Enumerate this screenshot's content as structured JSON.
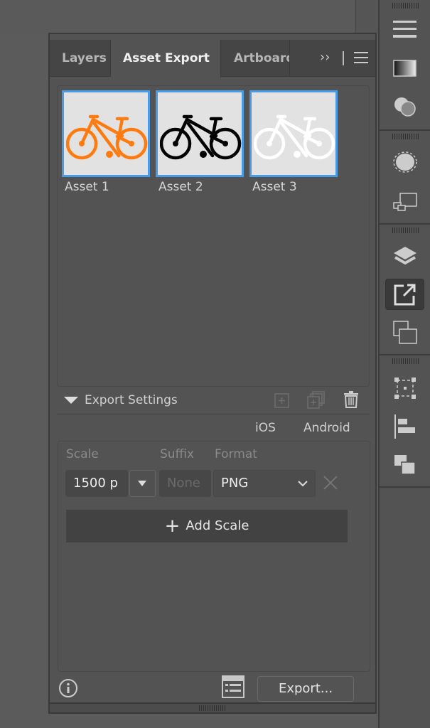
{
  "panel": {
    "tabs": [
      {
        "label": "Layers",
        "active": false
      },
      {
        "label": "Asset Export",
        "active": true
      },
      {
        "label": "Artboards",
        "active": false
      }
    ],
    "overflow_icon": "double-chevron-right-icon",
    "menu_icon": "hamburger-menu-icon",
    "assets": [
      {
        "label": "Asset 1",
        "color": "#ff7a0f",
        "selected": true
      },
      {
        "label": "Asset 2",
        "color": "#000000",
        "selected": true
      },
      {
        "label": "Asset 3",
        "color": "#ffffff",
        "selected": true
      }
    ],
    "export_settings": {
      "title": "Export Settings",
      "presets": [
        "iOS",
        "Android"
      ],
      "scale_label": "Scale",
      "suffix_label": "Suffix",
      "format_label": "Format",
      "scale_value": "1500 p",
      "suffix_placeholder": "None",
      "format_value": "PNG",
      "add_scale_label": "Add Scale"
    },
    "export_button": "Export..."
  },
  "colors": {
    "selection": "#4a9be6",
    "panel_bg": "#535353"
  }
}
